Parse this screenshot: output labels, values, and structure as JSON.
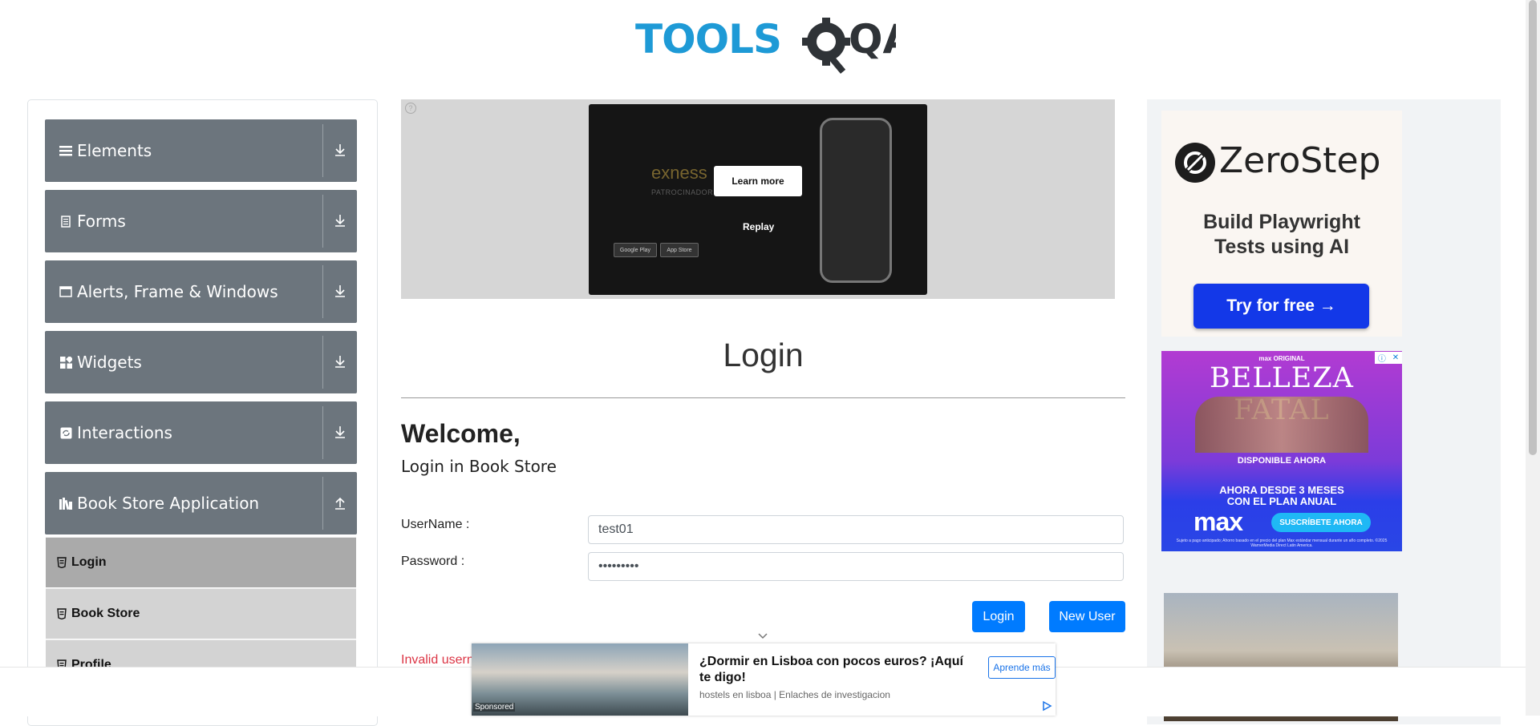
{
  "header": {
    "logo_text_tools": "TOOLS",
    "logo_text_qa": "QA"
  },
  "sidebar": {
    "groups": [
      {
        "label": "Elements",
        "icon": "hamburger-icon"
      },
      {
        "label": "Forms",
        "icon": "document-icon"
      },
      {
        "label": "Alerts, Frame & Windows",
        "icon": "window-icon"
      },
      {
        "label": "Widgets",
        "icon": "widgets-grid-icon"
      },
      {
        "label": "Interactions",
        "icon": "interactions-icon"
      },
      {
        "label": "Book Store Application",
        "icon": "books-icon"
      }
    ],
    "book_store_items": [
      {
        "label": "Login",
        "active": true
      },
      {
        "label": "Book Store",
        "active": false
      },
      {
        "label": "Profile",
        "active": false
      }
    ]
  },
  "center_ad": {
    "brand": "exness",
    "brand_sub": "PATROCINADOR REG",
    "learn_more": "Learn more",
    "replay": "Replay",
    "store_google": "Google Play",
    "store_apple": "App Store"
  },
  "login": {
    "title": "Login",
    "welcome": "Welcome,",
    "subheading": "Login in Book Store",
    "username_label": "UserName :",
    "username_value": "test01",
    "password_label": "Password :",
    "password_value": "•••••••••",
    "login_button": "Login",
    "new_user_button": "New User",
    "error_text": "Invalid usern"
  },
  "right_ads": {
    "zerostep": {
      "title": "ZeroStep",
      "subtitle_line1": "Build Playwright",
      "subtitle_line2": "Tests using AI",
      "cta": "Try for free →"
    },
    "max": {
      "top": "max ORIGINAL",
      "title": "BELLEZA FATAL",
      "available": "DISPONIBLE AHORA",
      "offer_line1": "AHORA DESDE 3 MESES",
      "offer_line2": "CON EL PLAN ANUAL",
      "logo": "max",
      "subscribe": "SUSCRÍBETE AHORA",
      "fine_print": "Sujeto a pago anticipado; Ahorro basado en el precio del plan Max estándar mensual durante un año completo. ©2025 WarnerMedia Direct Latin America."
    }
  },
  "sponsored": {
    "label": "Sponsored",
    "title": "¿Dormir en Lisboa con pocos euros? ¡Aquí te digo!",
    "source": "hostels en lisboa | Enlaches de investigacion",
    "cta": "Aprende más"
  },
  "colors": {
    "sidebar_group": "#6c757d",
    "sub_active": "#aaaaaa",
    "primary_button": "#007bff",
    "error": "#dc3545",
    "logo_blue": "#1e9ad6",
    "logo_dark": "#2f3337"
  }
}
